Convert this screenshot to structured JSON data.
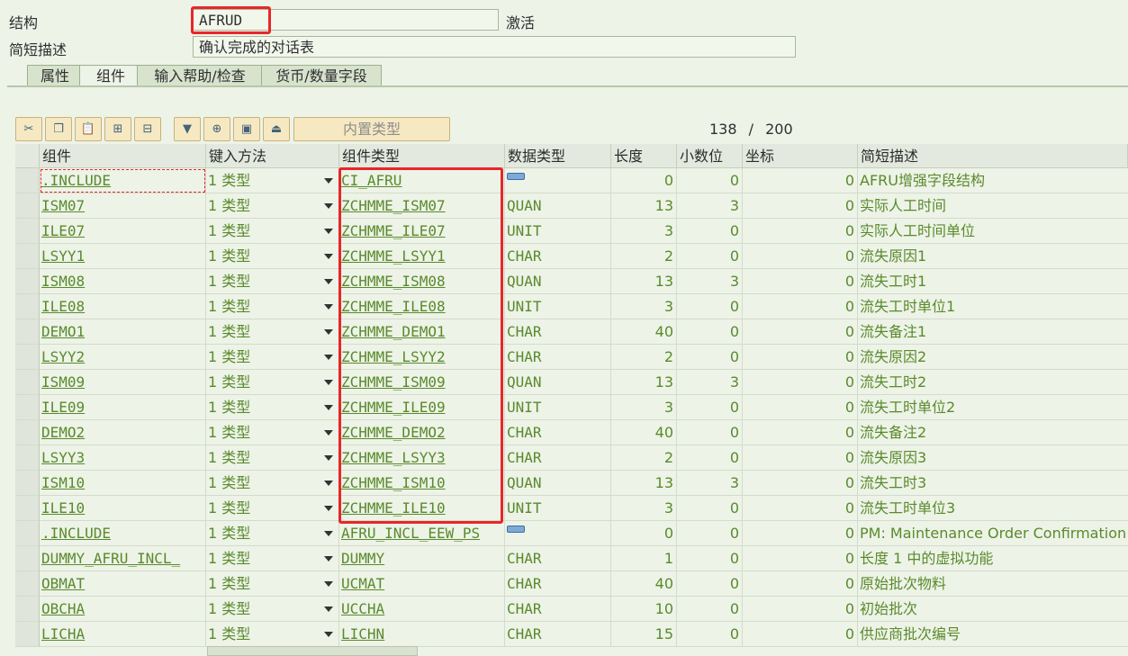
{
  "header": {
    "struct_label": "结构",
    "struct_value": "AFRUD",
    "status": "激活",
    "desc_label": "简短描述",
    "desc_value": "确认完成的对话表"
  },
  "tabs": [
    {
      "label": "属性"
    },
    {
      "label": "组件"
    },
    {
      "label": "输入帮助/检查"
    },
    {
      "label": "货币/数量字段"
    }
  ],
  "toolbar": {
    "buttons": [
      "cut-icon",
      "copy-icon",
      "paste-icon",
      "insert-row-icon",
      "delete-row-icon",
      "filter-icon",
      "expand-icon",
      "detail-icon",
      "sort-icon"
    ],
    "builtin_type_label": "内置类型",
    "counter_current": "138",
    "counter_sep": "/",
    "counter_total": "200"
  },
  "columns": [
    "组件",
    "键入方法",
    "组件类型",
    "数据类型",
    "长度",
    "小数位",
    "坐标",
    "简短描述"
  ],
  "rows": [
    {
      "comp": ".INCLUDE",
      "km": "1 类型",
      "ctype": "CI_AFRU",
      "dtype": "",
      "len": "0",
      "dec": "0",
      "coord": "0",
      "desc": "AFRU增强字段结构",
      "struct": true
    },
    {
      "comp": "ISM07",
      "km": "1 类型",
      "ctype": "ZCHMME_ISM07",
      "dtype": "QUAN",
      "len": "13",
      "dec": "3",
      "coord": "0",
      "desc": "实际人工时间"
    },
    {
      "comp": "ILE07",
      "km": "1 类型",
      "ctype": "ZCHMME_ILE07",
      "dtype": "UNIT",
      "len": "3",
      "dec": "0",
      "coord": "0",
      "desc": "实际人工时间单位"
    },
    {
      "comp": "LSYY1",
      "km": "1 类型",
      "ctype": "ZCHMME_LSYY1",
      "dtype": "CHAR",
      "len": "2",
      "dec": "0",
      "coord": "0",
      "desc": "流失原因1"
    },
    {
      "comp": "ISM08",
      "km": "1 类型",
      "ctype": "ZCHMME_ISM08",
      "dtype": "QUAN",
      "len": "13",
      "dec": "3",
      "coord": "0",
      "desc": "流失工时1"
    },
    {
      "comp": "ILE08",
      "km": "1 类型",
      "ctype": "ZCHMME_ILE08",
      "dtype": "UNIT",
      "len": "3",
      "dec": "0",
      "coord": "0",
      "desc": "流失工时单位1"
    },
    {
      "comp": "DEMO1",
      "km": "1 类型",
      "ctype": "ZCHMME_DEMO1",
      "dtype": "CHAR",
      "len": "40",
      "dec": "0",
      "coord": "0",
      "desc": "流失备注1"
    },
    {
      "comp": "LSYY2",
      "km": "1 类型",
      "ctype": "ZCHMME_LSYY2",
      "dtype": "CHAR",
      "len": "2",
      "dec": "0",
      "coord": "0",
      "desc": "流失原因2"
    },
    {
      "comp": "ISM09",
      "km": "1 类型",
      "ctype": "ZCHMME_ISM09",
      "dtype": "QUAN",
      "len": "13",
      "dec": "3",
      "coord": "0",
      "desc": "流失工时2"
    },
    {
      "comp": "ILE09",
      "km": "1 类型",
      "ctype": "ZCHMME_ILE09",
      "dtype": "UNIT",
      "len": "3",
      "dec": "0",
      "coord": "0",
      "desc": "流失工时单位2"
    },
    {
      "comp": "DEMO2",
      "km": "1 类型",
      "ctype": "ZCHMME_DEMO2",
      "dtype": "CHAR",
      "len": "40",
      "dec": "0",
      "coord": "0",
      "desc": "流失备注2"
    },
    {
      "comp": "LSYY3",
      "km": "1 类型",
      "ctype": "ZCHMME_LSYY3",
      "dtype": "CHAR",
      "len": "2",
      "dec": "0",
      "coord": "0",
      "desc": "流失原因3"
    },
    {
      "comp": "ISM10",
      "km": "1 类型",
      "ctype": "ZCHMME_ISM10",
      "dtype": "QUAN",
      "len": "13",
      "dec": "3",
      "coord": "0",
      "desc": "流失工时3"
    },
    {
      "comp": "ILE10",
      "km": "1 类型",
      "ctype": "ZCHMME_ILE10",
      "dtype": "UNIT",
      "len": "3",
      "dec": "0",
      "coord": "0",
      "desc": "流失工时单位3"
    },
    {
      "comp": ".INCLUDE",
      "km": "1 类型",
      "ctype": "AFRU_INCL_EEW_PS",
      "dtype": "",
      "len": "0",
      "dec": "0",
      "coord": "0",
      "desc": "PM: Maintenance Order Confirmation Pers",
      "struct": true
    },
    {
      "comp": "DUMMY_AFRU_INCL_",
      "km": "1 类型",
      "ctype": "DUMMY",
      "dtype": "CHAR",
      "len": "1",
      "dec": "0",
      "coord": "0",
      "desc": "长度 1 中的虚拟功能"
    },
    {
      "comp": "OBMAT",
      "km": "1 类型",
      "ctype": "UCMAT",
      "dtype": "CHAR",
      "len": "40",
      "dec": "0",
      "coord": "0",
      "desc": "原始批次物料"
    },
    {
      "comp": "OBCHA",
      "km": "1 类型",
      "ctype": "UCCHA",
      "dtype": "CHAR",
      "len": "10",
      "dec": "0",
      "coord": "0",
      "desc": "初始批次"
    },
    {
      "comp": "LICHA",
      "km": "1 类型",
      "ctype": "LICHN",
      "dtype": "CHAR",
      "len": "15",
      "dec": "0",
      "coord": "0",
      "desc": "供应商批次编号"
    }
  ]
}
